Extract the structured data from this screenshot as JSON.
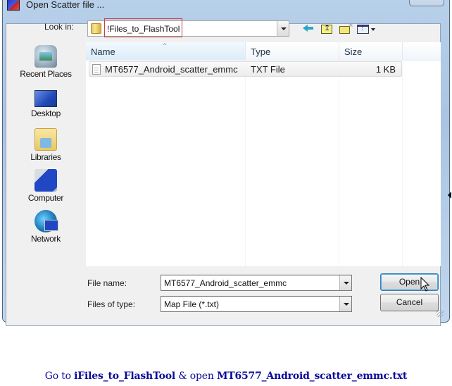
{
  "window": {
    "title": "Open Scatter file ...",
    "close_glyph": "✕",
    "icon": "app-icon"
  },
  "lookin": {
    "label": "Look in:",
    "value": "!Files_to_FlashTool",
    "highlight_color": "#d23a3a"
  },
  "toolbar": {
    "items": [
      "back-icon",
      "up-one-level-icon",
      "new-folder-icon",
      "view-menu-icon"
    ]
  },
  "sidebar": {
    "items": [
      {
        "label": "Recent Places",
        "icon": "recent-places-icon"
      },
      {
        "label": "Desktop",
        "icon": "desktop-icon"
      },
      {
        "label": "Libraries",
        "icon": "libraries-icon"
      },
      {
        "label": "Computer",
        "icon": "computer-icon"
      },
      {
        "label": "Network",
        "icon": "network-icon"
      }
    ]
  },
  "filelist": {
    "columns": [
      "Name",
      "Type",
      "Size"
    ],
    "sort_indicator": "^",
    "rows": [
      {
        "name": "MT6577_Android_scatter_emmc",
        "type": "TXT File",
        "size": "1 KB"
      }
    ]
  },
  "bottom": {
    "filename_label": "File name:",
    "filename_value": "MT6577_Android_scatter_emmc",
    "filetype_label": "Files of type:",
    "filetype_value": "Map File (*.txt)",
    "open_label": "Open",
    "cancel_label": "Cancel"
  },
  "caption": {
    "prefix": "Go to ",
    "folder": "iFiles_to_FlashTool",
    "middle": " & open ",
    "file": "MT6577_Android_scatter_emmc.txt",
    "color": "#0a0a9a"
  }
}
